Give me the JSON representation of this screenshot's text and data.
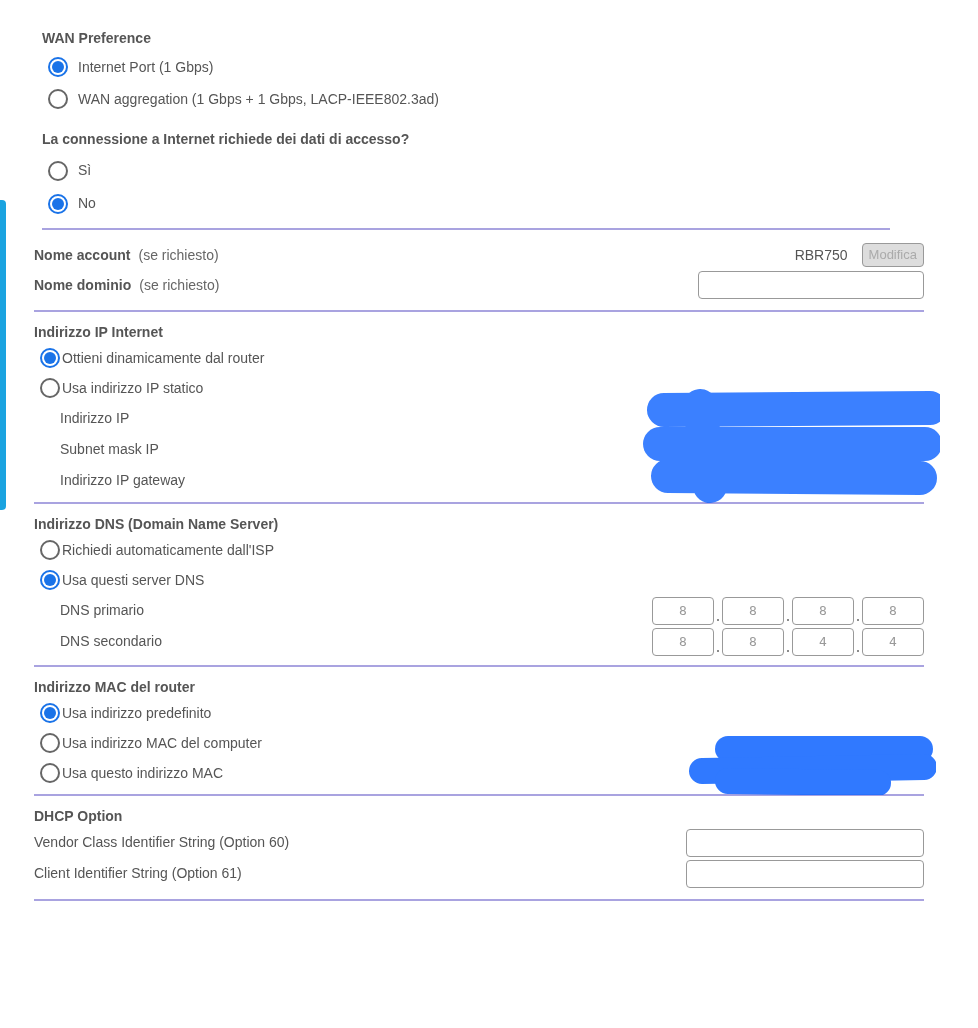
{
  "wan_preference": {
    "title": "WAN Preference",
    "options": [
      {
        "label": "Internet Port (1 Gbps)",
        "selected": true
      },
      {
        "label": "WAN aggregation (1 Gbps + 1 Gbps, LACP-IEEE802.3ad)",
        "selected": false
      }
    ]
  },
  "login_required": {
    "title": "La connessione a Internet richiede dei dati di accesso?",
    "options": [
      {
        "label": "Sì",
        "selected": false
      },
      {
        "label": "No",
        "selected": true
      }
    ]
  },
  "account": {
    "label": "Nome account",
    "hint": "(se richiesto)",
    "value": "RBR750",
    "button": {
      "label": "Modifica",
      "disabled": true
    }
  },
  "domain": {
    "label": "Nome dominio",
    "hint": "(se richiesto)"
  },
  "ip_section": {
    "title": "Indirizzo IP Internet",
    "options": [
      {
        "label": "Ottieni dinamicamente dal router",
        "selected": true
      },
      {
        "label": "Usa indirizzo IP statico",
        "selected": false
      }
    ],
    "fields": [
      {
        "label": "Indirizzo IP"
      },
      {
        "label": "Subnet mask IP"
      },
      {
        "label": "Indirizzo IP gateway"
      }
    ]
  },
  "dns_section": {
    "title": "Indirizzo DNS (Domain Name Server)",
    "options": [
      {
        "label": "Richiedi automaticamente dall'ISP",
        "selected": false
      },
      {
        "label": "Usa questi server DNS",
        "selected": true
      }
    ],
    "fields": [
      {
        "label": "DNS primario",
        "octets": [
          "8",
          "8",
          "8",
          "8"
        ]
      },
      {
        "label": "DNS secondario",
        "octets": [
          "8",
          "8",
          "4",
          "4"
        ]
      }
    ]
  },
  "mac_section": {
    "title": "Indirizzo MAC del router",
    "options": [
      {
        "label": "Usa indirizzo predefinito",
        "selected": true
      },
      {
        "label": "Usa indirizzo MAC del computer",
        "selected": false
      },
      {
        "label": "Usa questo indirizzo MAC",
        "selected": false
      }
    ]
  },
  "dhcp": {
    "title": "DHCP Option",
    "fields": [
      {
        "label": "Vendor Class Identifier String (Option 60)"
      },
      {
        "label": "Client Identifier String (Option 61)"
      }
    ]
  }
}
